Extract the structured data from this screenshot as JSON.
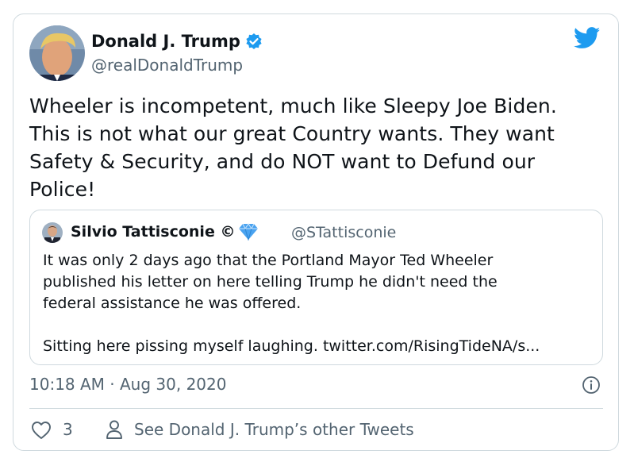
{
  "author": {
    "name": "Donald J. Trump",
    "handle": "@realDonaldTrump"
  },
  "tweet": {
    "text": "Wheeler is incompetent, much like Sleepy Joe Biden.\nThis is not what our great Country wants. They want\nSafety & Security, and do NOT want to Defund our\nPolice!"
  },
  "quoted_tweet": {
    "name": "Silvio Tattisconie ©",
    "handle": "@STattisconie",
    "text": "It was only 2 days ago that the Portland Mayor Ted Wheeler\npublished his letter on here telling Trump he didn't need the\nfederal assistance he was offered.\n\nSitting here pissing myself laughing. twitter.com/RisingTideNA/s..."
  },
  "meta": {
    "timestamp": "10:18 AM · Aug 30, 2020"
  },
  "actions": {
    "like_count": "3",
    "see_other_tweets": "See Donald J. Trump’s other Tweets"
  },
  "icons": {
    "brand": "twitter-bird-icon",
    "verified": "verified-badge-icon",
    "gem": "gem-icon",
    "info": "info-icon",
    "heart": "heart-icon",
    "person": "person-icon"
  },
  "colors": {
    "twitter_blue": "#1d9bf0",
    "secondary_text": "#536471",
    "border": "#cfd9de"
  }
}
